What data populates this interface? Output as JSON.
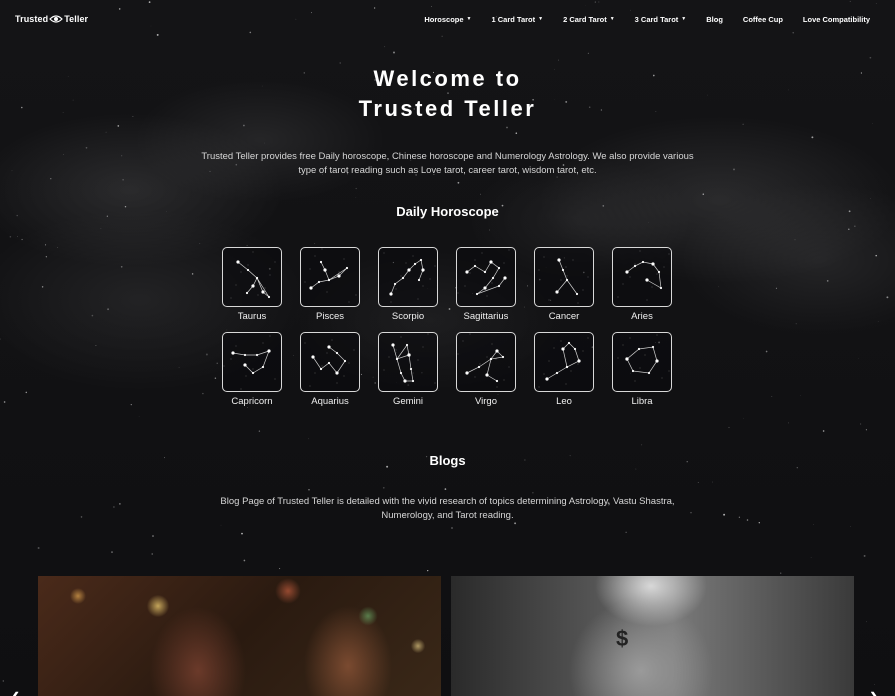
{
  "nav": {
    "logo_left": "Trusted",
    "logo_right": "Teller",
    "items": [
      {
        "label": "Horoscope",
        "dropdown": true
      },
      {
        "label": "1 Card Tarot",
        "dropdown": true
      },
      {
        "label": "2 Card Tarot",
        "dropdown": true
      },
      {
        "label": "3 Card Tarot",
        "dropdown": true
      },
      {
        "label": "Blog",
        "dropdown": false
      },
      {
        "label": "Coffee Cup",
        "dropdown": false
      },
      {
        "label": "Love Compatibility",
        "dropdown": false
      }
    ]
  },
  "hero": {
    "title_line1": "Welcome to",
    "title_line2": "Trusted Teller",
    "description": "Trusted Teller provides free Daily horoscope, Chinese horoscope and Numerology Astrology. We also provide various type of tarot reading such as Love tarot, career tarot, wisdom tarot, etc."
  },
  "daily_horoscope": {
    "title": "Daily Horoscope",
    "signs": [
      "Taurus",
      "Pisces",
      "Scorpio",
      "Sagittarius",
      "Cancer",
      "Aries",
      "Capricorn",
      "Aquarius",
      "Gemini",
      "Virgo",
      "Leo",
      "Libra"
    ]
  },
  "blogs": {
    "title": "Blogs",
    "description": "Blog Page of Trusted Teller is detailed with the vivid research of topics determining Astrology, Vastu Shastra, Numerology, and Tarot reading."
  },
  "carousel": {
    "prev_glyph": "‹",
    "next_glyph": "›",
    "card_2_mark": "$"
  },
  "colors": {
    "background": "#111113",
    "text": "#ffffff",
    "muted_text": "#d6d6d6",
    "tile_border": "#d8d8d8"
  }
}
